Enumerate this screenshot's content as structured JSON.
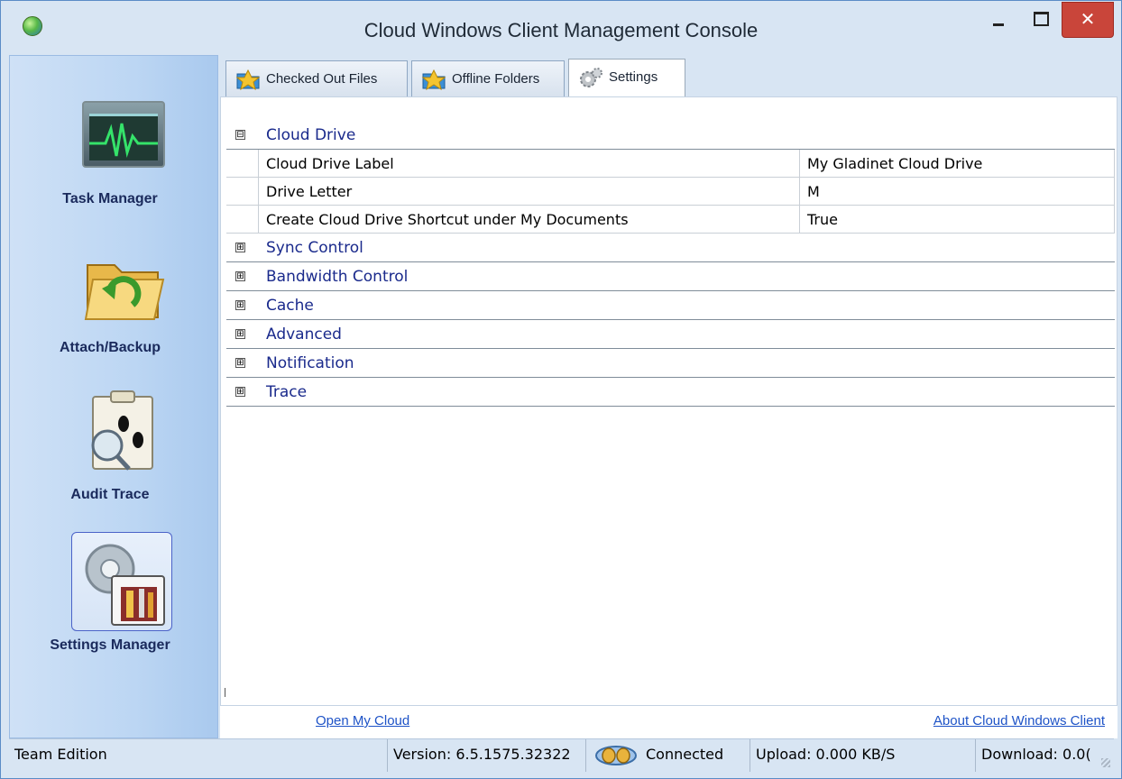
{
  "window": {
    "title": "Cloud Windows Client Management Console",
    "close_glyph": "✕"
  },
  "sidebar": {
    "items": [
      {
        "label": "Task Manager",
        "icon": "task-manager-icon"
      },
      {
        "label": "Attach/Backup",
        "icon": "attach-backup-icon"
      },
      {
        "label": "Audit Trace",
        "icon": "audit-trace-icon"
      },
      {
        "label": "Settings Manager",
        "icon": "settings-manager-icon",
        "selected": true
      }
    ]
  },
  "tabs": [
    {
      "label": "Checked Out Files",
      "icon": "checked-out-files-icon"
    },
    {
      "label": "Offline Folders",
      "icon": "offline-folders-icon"
    },
    {
      "label": "Settings",
      "icon": "settings-gears-icon",
      "active": true
    }
  ],
  "settings_grid": {
    "categories": [
      {
        "label": "Cloud Drive",
        "toggle": "⊟",
        "expanded": true,
        "properties": [
          {
            "name": "Cloud Drive Label",
            "value": "My Gladinet Cloud Drive"
          },
          {
            "name": "Drive Letter",
            "value": "M"
          },
          {
            "name": "Create Cloud Drive Shortcut under My Documents",
            "value": "True"
          }
        ]
      },
      {
        "label": "Sync Control",
        "toggle": "⊞",
        "expanded": false
      },
      {
        "label": "Bandwidth Control",
        "toggle": "⊞",
        "expanded": false
      },
      {
        "label": "Cache",
        "toggle": "⊞",
        "expanded": false
      },
      {
        "label": "Advanced",
        "toggle": "⊞",
        "expanded": false
      },
      {
        "label": "Notification",
        "toggle": "⊞",
        "expanded": false
      },
      {
        "label": "Trace",
        "toggle": "⊞",
        "expanded": false
      }
    ]
  },
  "links": {
    "open_my_cloud": "Open My Cloud",
    "about": "About Cloud Windows Client"
  },
  "status_bar": {
    "edition": "Team Edition",
    "version": "Version: 6.5.1575.32322",
    "connection": "Connected",
    "upload": "Upload: 0.000 KB/S",
    "download": "Download: 0.0("
  },
  "colors": {
    "accent": "#1a2a8c",
    "link": "#1e53c7",
    "close_button": "#c9453a",
    "chrome": "#d8e5f3"
  }
}
